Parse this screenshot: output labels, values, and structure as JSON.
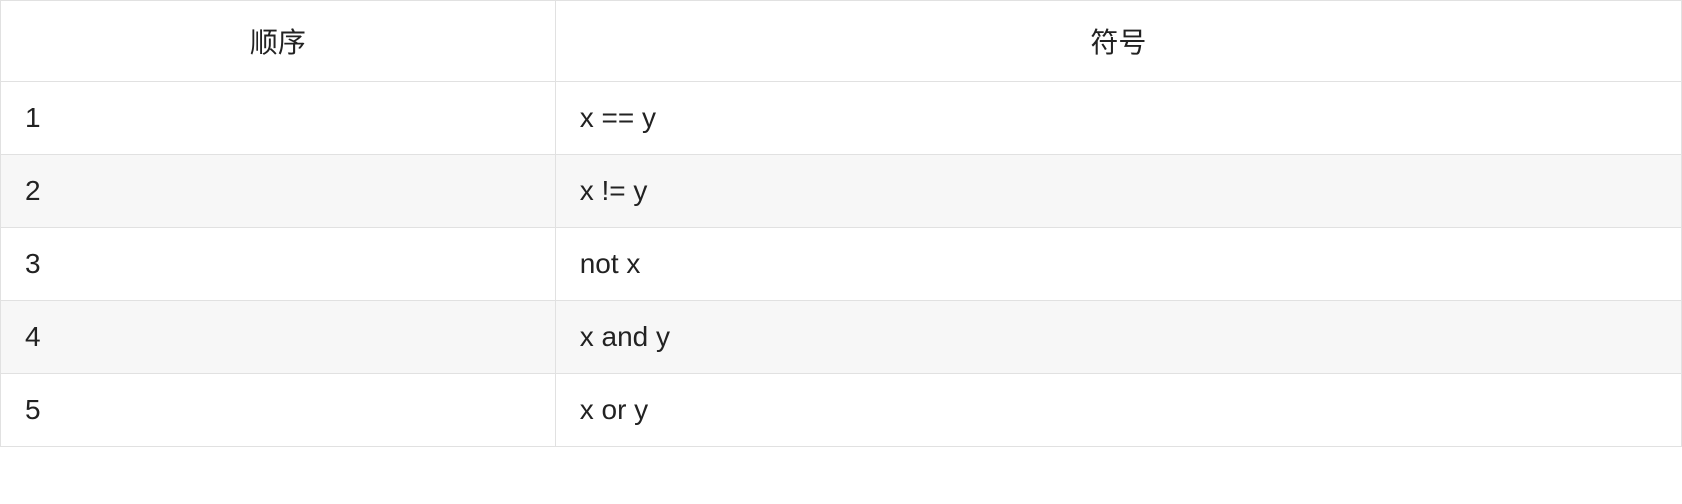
{
  "table": {
    "headers": {
      "order": "顺序",
      "symbol": "符号"
    },
    "rows": [
      {
        "order": "1",
        "symbol": "x == y"
      },
      {
        "order": "2",
        "symbol": "x != y"
      },
      {
        "order": "3",
        "symbol": "not x"
      },
      {
        "order": "4",
        "symbol": "x and y"
      },
      {
        "order": "5",
        "symbol": "x or y"
      }
    ]
  }
}
